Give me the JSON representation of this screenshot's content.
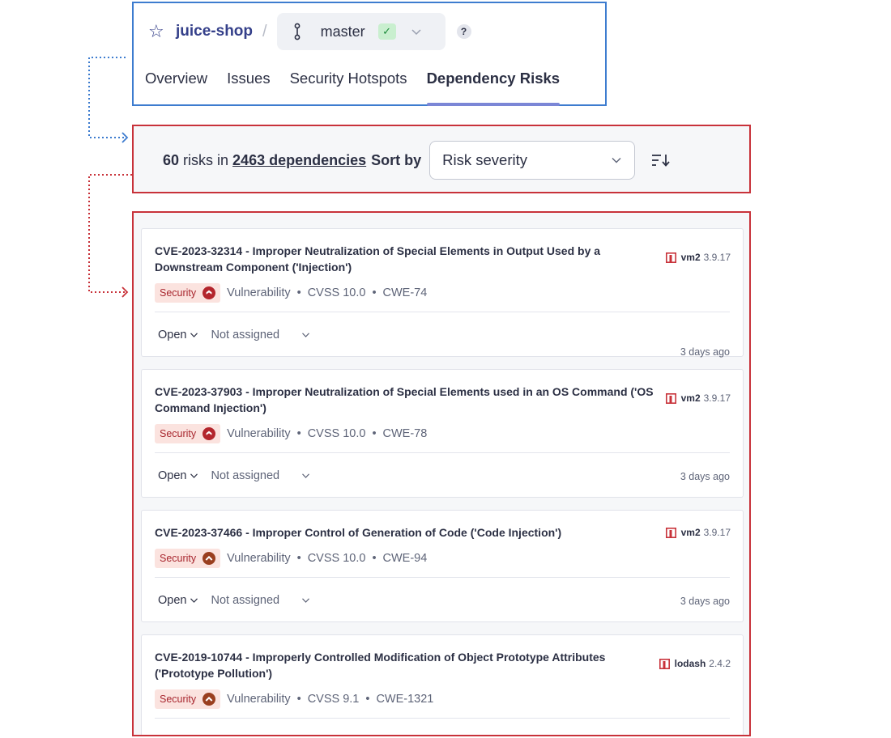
{
  "header": {
    "project_name": "juice-shop",
    "separator": "/",
    "branch": "master",
    "help": "?",
    "tabs": [
      {
        "label": "Overview",
        "active": false
      },
      {
        "label": "Issues",
        "active": false
      },
      {
        "label": "Security Hotspots",
        "active": false
      },
      {
        "label": "Dependency Risks",
        "active": true
      }
    ]
  },
  "sort_bar": {
    "risk_count": "60",
    "risks_in": "risks in",
    "dependencies_link": "2463 dependencies",
    "sort_by_label": "Sort by",
    "sort_value": "Risk severity"
  },
  "risks": [
    {
      "title": "CVE-2023-32314 - Improper Neutralization of Special Elements in Output Used by a Downstream Component ('Injection')",
      "badge": "Security",
      "type": "Vulnerability",
      "cvss": "CVSS 10.0",
      "cwe": "CWE-74",
      "package": "vm2",
      "version": "3.9.17",
      "status": "Open",
      "assignee": "Not assigned",
      "age": "3 days ago",
      "severity": "blocker"
    },
    {
      "title": "CVE-2023-37903 - Improper Neutralization of Special Elements used in an OS Command ('OS Command Injection')",
      "badge": "Security",
      "type": "Vulnerability",
      "cvss": "CVSS 10.0",
      "cwe": "CWE-78",
      "package": "vm2",
      "version": "3.9.17",
      "status": "Open",
      "assignee": "Not assigned",
      "age": "3 days ago",
      "severity": "blocker"
    },
    {
      "title": "CVE-2023-37466 - Improper Control of Generation of Code ('Code Injection')",
      "badge": "Security",
      "type": "Vulnerability",
      "cvss": "CVSS 10.0",
      "cwe": "CWE-94",
      "package": "vm2",
      "version": "3.9.17",
      "status": "Open",
      "assignee": "Not assigned",
      "age": "3 days ago",
      "severity": "high"
    },
    {
      "title": "CVE-2019-10744 - Improperly Controlled Modification of Object Prototype Attributes ('Prototype Pollution')",
      "badge": "Security",
      "type": "Vulnerability",
      "cvss": "CVSS 9.1",
      "cwe": "CWE-1321",
      "package": "lodash",
      "version": "2.4.2",
      "severity": "high"
    }
  ],
  "colors": {
    "header_outline": "#3d7ccf",
    "highlight_outline": "#c8323a",
    "project_link": "#35408a",
    "active_tab_underline": "#7b86d6",
    "security_badge_bg": "#fbe3df",
    "severity_blocker": "#b3262d",
    "severity_high": "#9a3f1f",
    "package_icon": "#c8323a"
  },
  "icons": {
    "favorite": "star-outline-icon",
    "branch": "branch-icon",
    "quality_gate": "check-icon",
    "sort_direction": "sort-descending-icon",
    "severity_blocker": "blocker-severity-icon",
    "severity_high": "high-severity-icon",
    "package": "npm-package-icon"
  }
}
